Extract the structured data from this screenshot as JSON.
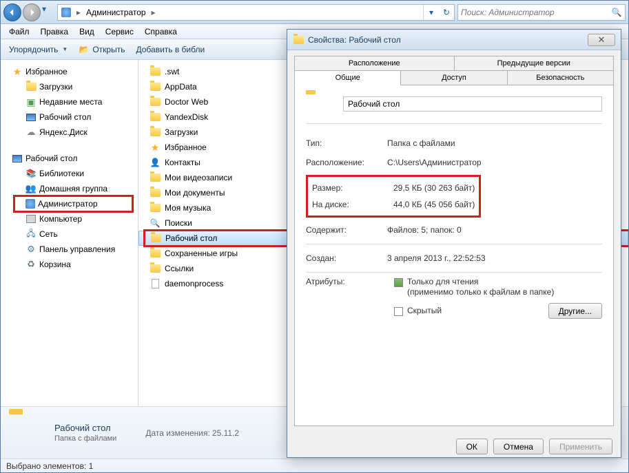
{
  "nav": {
    "breadcrumb_root": "Администратор",
    "search_placeholder": "Поиск: Администратор"
  },
  "menu": {
    "file": "Файл",
    "edit": "Правка",
    "view": "Вид",
    "tools": "Сервис",
    "help": "Справка"
  },
  "toolbar": {
    "organize": "Упорядочить",
    "open": "Открыть",
    "add_library": "Добавить в библи"
  },
  "tree": {
    "favorites": "Избранное",
    "downloads": "Загрузки",
    "recent": "Недавние места",
    "desktop_fav": "Рабочий стол",
    "yandex_disk": "Яндекс.Диск",
    "desktop": "Рабочий стол",
    "libraries": "Библиотеки",
    "homegroup": "Домашняя группа",
    "administrator": "Администратор",
    "computer": "Компьютер",
    "network": "Сеть",
    "control_panel": "Панель управления",
    "recycle_bin": "Корзина"
  },
  "content": {
    "items": [
      ".swt",
      "AppData",
      "Doctor Web",
      "YandexDisk",
      "Загрузки",
      "Избранное",
      "Контакты",
      "Мои видеозаписи",
      "Мои документы",
      "Моя музыка",
      "Поиски",
      "Рабочий стол",
      "Сохраненные игры",
      "Ссылки",
      "daemonprocess"
    ],
    "selected_index": 11
  },
  "details": {
    "title": "Рабочий стол",
    "subtitle": "Папка с файлами",
    "date_label": "Дата изменения:",
    "date_value": "25.11.2"
  },
  "status": {
    "text": "Выбрано элементов: 1"
  },
  "dialog": {
    "title": "Свойства: Рабочий стол",
    "tabs": {
      "location": "Расположение",
      "previous": "Предыдущие версии",
      "general": "Общие",
      "sharing": "Доступ",
      "security": "Безопасность"
    },
    "name": "Рабочий стол",
    "type_label": "Тип:",
    "type_value": "Папка с файлами",
    "location_label": "Расположение:",
    "location_value": "C:\\Users\\Администратор",
    "size_label": "Размер:",
    "size_value": "29,5 КБ (30 263 байт)",
    "ondisk_label": "На диске:",
    "ondisk_value": "44,0 КБ (45 056 байт)",
    "contains_label": "Содержит:",
    "contains_value": "Файлов: 5; папок: 0",
    "created_label": "Создан:",
    "created_value": "3 апреля 2013 г., 22:52:53",
    "attributes_label": "Атрибуты:",
    "readonly_label": "Только для чтения",
    "readonly_note": "(применимо только к файлам в папке)",
    "hidden_label": "Скрытый",
    "other_btn": "Другие...",
    "ok": "ОК",
    "cancel": "Отмена",
    "apply": "Применить"
  }
}
